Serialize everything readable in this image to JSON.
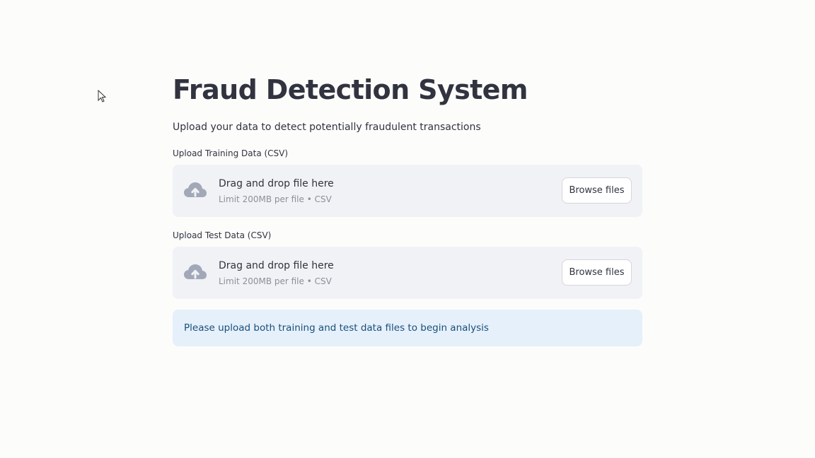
{
  "page": {
    "title": "Fraud Detection System",
    "subtitle": "Upload your data to detect potentially fraudulent transactions"
  },
  "uploaders": [
    {
      "label": "Upload Training Data (CSV)",
      "drop_text": "Drag and drop file here",
      "limit_text": "Limit 200MB per file • CSV",
      "button_label": "Browse files",
      "icon": "cloud-upload-icon"
    },
    {
      "label": "Upload Test Data (CSV)",
      "drop_text": "Drag and drop file here",
      "limit_text": "Limit 200MB per file • CSV",
      "button_label": "Browse files",
      "icon": "cloud-upload-icon"
    }
  ],
  "info": {
    "message": "Please upload both training and test data files to begin analysis"
  },
  "colors": {
    "background": "#fcfcfb",
    "dropzone": "#f0f2f6",
    "info_background": "#e6f0fa",
    "info_text": "#174f7a",
    "icon": "#a3a8b8"
  }
}
